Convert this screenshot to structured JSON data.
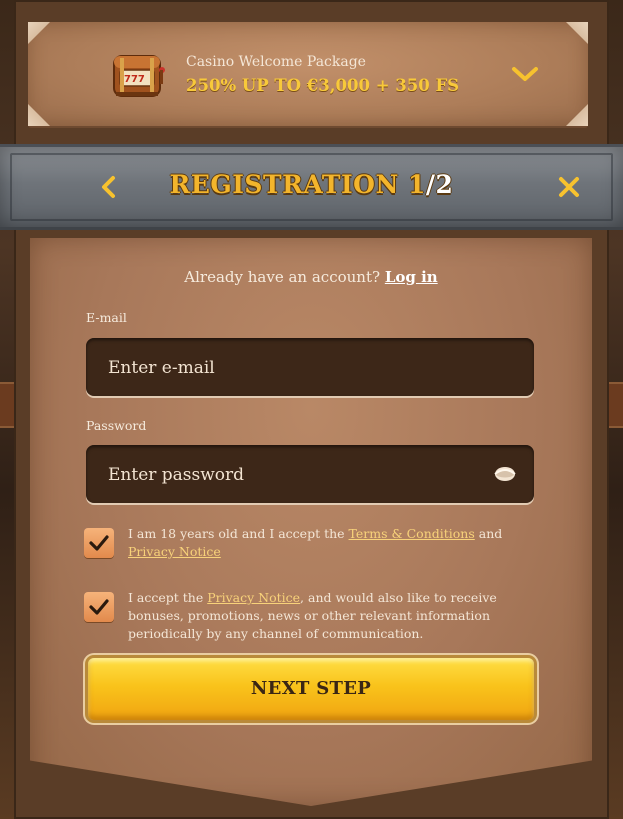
{
  "promo": {
    "title": "Casino Welcome Package",
    "offer": "250% UP TO €3,000 + 350 FS",
    "chest_icon": "slot-chest-icon",
    "expand_icon": "chevron-down-icon"
  },
  "header": {
    "title": "REGISTRATION 1",
    "step_suffix": "/2",
    "back_icon": "chevron-left-icon",
    "close_icon": "close-icon"
  },
  "form": {
    "have_account_text": "Already have an account?",
    "login_link": "Log in",
    "email_label": "E-mail",
    "email_placeholder": "Enter e-mail",
    "password_label": "Password",
    "password_placeholder": "Enter password",
    "eye_icon": "eye-icon",
    "consent1": {
      "checked": true,
      "text_before": "I am 18 years old and I accept the ",
      "link1": "Terms & Conditions",
      "text_mid": " and ",
      "link2": "Privacy Notice"
    },
    "consent2": {
      "checked": true,
      "text_before": "I accept the ",
      "link1": "Privacy Notice",
      "text_after": ", and would also like to receive bonuses, promotions, news or other relevant information periodically by any channel of communication."
    },
    "next_button": "NEXT STEP"
  },
  "colors": {
    "accent_yellow": "#f3b52c",
    "parchment": "#a8785a",
    "field_bg": "#3d2718",
    "checkbox": "#e28a4c"
  }
}
